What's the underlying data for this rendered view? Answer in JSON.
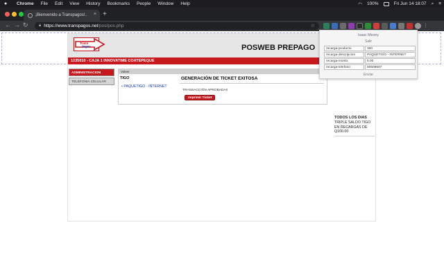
{
  "menubar": {
    "apple": "",
    "items": [
      "Chrome",
      "File",
      "Edit",
      "View",
      "History",
      "Bookmarks",
      "People",
      "Window",
      "Help"
    ],
    "battery": "100%",
    "clock": "Fri Jun 14  18:07"
  },
  "tab": {
    "title": "¡Bienvenido a Transpagos!..",
    "close": "×",
    "new": "+"
  },
  "toolbar": {
    "back": "←",
    "forward": "→",
    "reload": "↻",
    "url_prefix": "https://www.transpagos.net",
    "url_path": "/pos/pos.php",
    "star": "☆"
  },
  "page": {
    "logo_text_1": "Trans",
    "logo_text_2": "Pagos",
    "title": "POSWEB PREPAGO",
    "account_bar": "1035010 - CAJA 1 INNOVATIME COATEPEQUE",
    "sidebar": [
      "ADMINISTRACION",
      "TELEFONIA CELULAR"
    ],
    "panel": {
      "volver": "Volver",
      "provider": "TIGO",
      "product": "PAQUETIGO - INTERNET",
      "heading": "GENERACIÓN DE TICKET EXITOSA",
      "status": "TRANSACCIÓN APROBADA!!",
      "print_button": "Imprimir Ticket"
    },
    "promo": {
      "heading": "TODOS LOS DIAS",
      "text": "TRIPLE SALDO TIGO EN RECARGAS DE Q100.00"
    }
  },
  "popup": {
    "user": "Isaac Meony",
    "logout": "Salir",
    "rows": [
      {
        "key": "recarga-producto",
        "value": "300"
      },
      {
        "key": "recarga-descripcion",
        "value": "PAQUETIGO - INTERNET"
      },
      {
        "key": "recarga-monto",
        "value": "5.00"
      },
      {
        "key": "recarga-telefono",
        "value": "50509607"
      }
    ],
    "send": "Enviar"
  },
  "colors": {
    "brand_red": "#c7181e",
    "link_blue": "#1a3aa8"
  }
}
